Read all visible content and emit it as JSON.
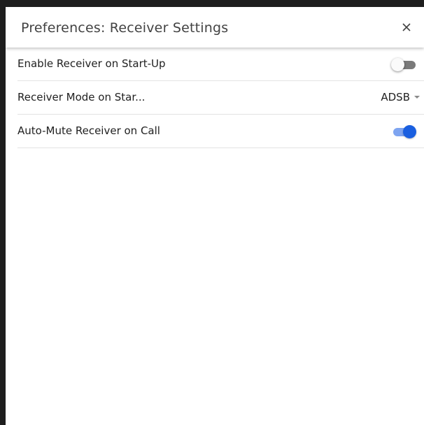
{
  "dialog": {
    "title": "Preferences: Receiver Settings",
    "close_icon": "close-icon"
  },
  "settings": [
    {
      "label": "Enable Receiver on Start-Up",
      "control": "toggle",
      "checked": false
    },
    {
      "label": "Receiver Mode on Star...",
      "control": "select",
      "selected": "ADSB"
    },
    {
      "label": "Auto-Mute Receiver on Call",
      "control": "toggle",
      "checked": true
    }
  ],
  "colors": {
    "toggle_on_thumb": "#1a5fe0",
    "toggle_on_track": "#7ea4f0",
    "toggle_off_track": "#7a7a7a"
  }
}
